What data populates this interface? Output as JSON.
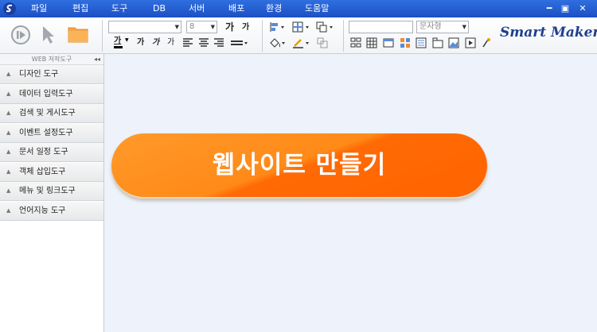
{
  "menu": [
    "파일",
    "편집",
    "도구",
    "DB",
    "서버",
    "배포",
    "환경",
    "도움말"
  ],
  "window_buttons": {
    "minimize": "━",
    "maximize": "▣",
    "close": "✕"
  },
  "toolbar": {
    "font_size_value": "8",
    "text_style_value": "문자형",
    "bold_label": "가",
    "italic_label": "가",
    "larger_label": "가",
    "smaller_label": "가",
    "underline_label": "가",
    "format_labels": [
      "가",
      "가",
      "가"
    ]
  },
  "brand": "Smart Maker",
  "sidebar": {
    "title": "WEB 저작도구",
    "collapse_symbol": "◂◂",
    "items": [
      "디자인 도구",
      "데이터 입력도구",
      "검색 및 게시도구",
      "이벤트 설정도구",
      "문서 일정 도구",
      "객체 삽입도구",
      "메뉴 및 링크도구",
      "언어지능 도구"
    ]
  },
  "main": {
    "cta_label": "웹사이트 만들기"
  },
  "colors": {
    "menubar": "#2a62d8",
    "cta_orange": "#ff7a10",
    "workspace_bg": "#eef3fb"
  }
}
